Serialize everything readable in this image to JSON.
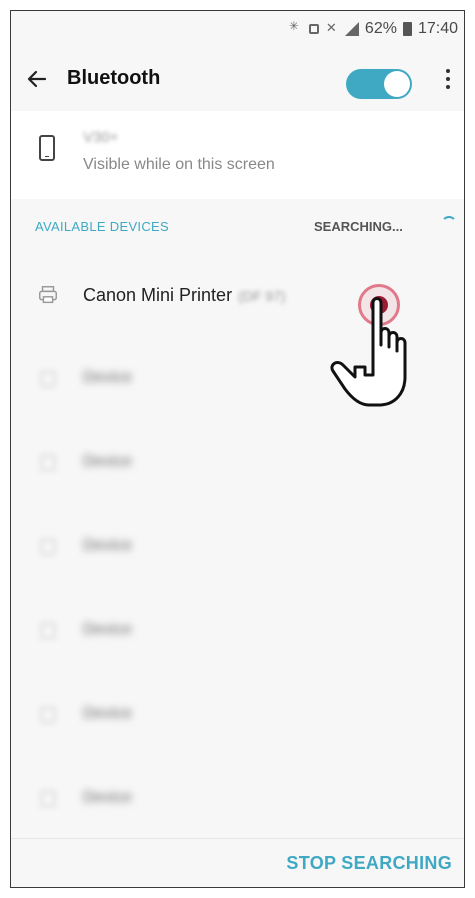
{
  "status_bar": {
    "battery_percent": "62%",
    "time": "17:40",
    "icons": [
      "bluetooth-icon",
      "nfc-icon",
      "mute-icon",
      "signal-icon",
      "battery-icon"
    ]
  },
  "app_bar": {
    "title": "Bluetooth",
    "toggle_state": "on",
    "accent_color": "#3fa9c4"
  },
  "this_device": {
    "name": "V30+",
    "subtitle": "Visible while on this screen"
  },
  "section": {
    "title": "AVAILABLE DEVICES",
    "status": "SEARCHING..."
  },
  "devices": [
    {
      "label": "Canon Mini Printer",
      "suffix": "(DF 97)",
      "icon": "printer-icon"
    },
    {
      "label": "Device",
      "icon": "device-icon"
    },
    {
      "label": "Device",
      "icon": "device-icon"
    },
    {
      "label": "Device",
      "icon": "device-icon"
    },
    {
      "label": "Device",
      "icon": "device-icon"
    },
    {
      "label": "Device",
      "icon": "device-icon"
    },
    {
      "label": "Device",
      "icon": "device-icon"
    }
  ],
  "bottom": {
    "action": "STOP SEARCHING"
  }
}
